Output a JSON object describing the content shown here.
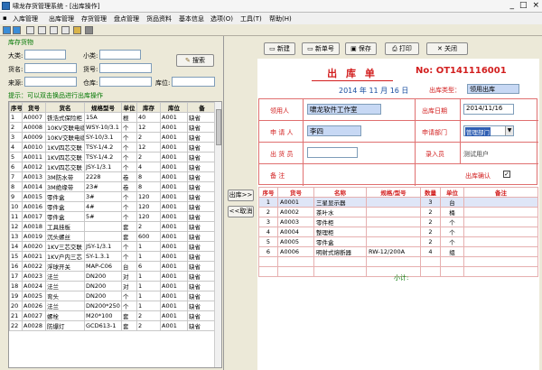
{
  "window": {
    "title": "啸龙存货管理系统 - [出库操作]",
    "controls": [
      "_",
      "□",
      "×"
    ]
  },
  "menu": [
    "入库管理",
    "出库管理",
    "存货管理",
    "盘点管理",
    "货品资料",
    "基本信息",
    "选项(O)",
    "工具(T)",
    "帮助(H)"
  ],
  "left": {
    "section_title": "库存货物",
    "filter": {
      "dalei_label": "大类:",
      "xiaolei_label": "小类:",
      "huoming_label": "货名:",
      "huohao_label": "货号:",
      "laiyuan_label": "来源:",
      "cangku_label": "仓库:",
      "kuwei_label": "库位:",
      "search_label": "搜索"
    },
    "hint": "提示：可以双击换品进行出库操作",
    "columns": [
      "序号",
      "货号",
      "货名",
      "规格型号",
      "单位",
      "库存",
      "库位",
      "备"
    ],
    "rows": [
      [
        "1",
        "A0007",
        "铁浩式保险柜",
        "15A",
        "根",
        "40",
        "A001",
        "缺省"
      ],
      [
        "2",
        "A0008",
        "10KV交联电缆",
        "WSY-10/3.1",
        "个",
        "12",
        "A001",
        "缺省"
      ],
      [
        "3",
        "A0009",
        "10KV交联电缆",
        "SY-10/3.1",
        "个",
        "2",
        "A001",
        "缺省"
      ],
      [
        "4",
        "A0010",
        "1KV四芯交联",
        "TSY-1/4.2",
        "个",
        "12",
        "A001",
        "缺省"
      ],
      [
        "5",
        "A0011",
        "1KV四芯交联",
        "TSY-1/4.2",
        "个",
        "2",
        "A001",
        "缺省"
      ],
      [
        "6",
        "A0012",
        "1KV四芯交联",
        "JSY-1/3.1",
        "个",
        "4",
        "A001",
        "缺省"
      ],
      [
        "7",
        "A0013",
        "3M防水带",
        "2228",
        "卷",
        "8",
        "A001",
        "缺省"
      ],
      [
        "8",
        "A0014",
        "3M绝缘带",
        "23#",
        "卷",
        "8",
        "A001",
        "缺省"
      ],
      [
        "9",
        "A0015",
        "零件盒",
        "3#",
        "个",
        "120",
        "A001",
        "缺省"
      ],
      [
        "10",
        "A0016",
        "零件盒",
        "4#",
        "个",
        "120",
        "A001",
        "缺省"
      ],
      [
        "11",
        "A0017",
        "零件盒",
        "5#",
        "个",
        "120",
        "A001",
        "缺省"
      ],
      [
        "12",
        "A0018",
        "工具挂板",
        "",
        "套",
        "2",
        "A001",
        "缺省"
      ],
      [
        "13",
        "A0019",
        "沉头螺丝",
        "",
        "套",
        "600",
        "A001",
        "缺省"
      ],
      [
        "14",
        "A0020",
        "1KV三芯交联",
        "JSY-1/3.1",
        "个",
        "1",
        "A001",
        "缺省"
      ],
      [
        "15",
        "A0021",
        "1KV户内三芯",
        "SY-1.3.1",
        "个",
        "1",
        "A001",
        "缺省"
      ],
      [
        "16",
        "A0022",
        "浮球开关",
        "MAP-C06",
        "台",
        "6",
        "A001",
        "缺省"
      ],
      [
        "17",
        "A0023",
        "法兰",
        "DN200",
        "对",
        "1",
        "A001",
        "缺省"
      ],
      [
        "18",
        "A0024",
        "法兰",
        "DN200",
        "对",
        "1",
        "A001",
        "缺省"
      ],
      [
        "19",
        "A0025",
        "弯头",
        "DN200",
        "个",
        "1",
        "A001",
        "缺省"
      ],
      [
        "20",
        "A0026",
        "法兰",
        "DN200*250",
        "个",
        "1",
        "A001",
        "缺省"
      ],
      [
        "21",
        "A0027",
        "螺栓",
        "M20*100",
        "套",
        "2",
        "A001",
        "缺省"
      ],
      [
        "22",
        "A0028",
        "防爆灯",
        "GCD613-1",
        "套",
        "2",
        "A001",
        "缺省"
      ]
    ]
  },
  "middle": {
    "out_button": "出库>>",
    "cancel_button": "<<取消"
  },
  "toolbar": {
    "new": "新建",
    "new_no": "新单号",
    "save": "保存",
    "print": "打印",
    "close": "关闭"
  },
  "form": {
    "title": "出 库 单",
    "number_label": "No:",
    "number": "OT141116001",
    "date": "2014 年 11 月 16 日",
    "type_label": "出库类型：",
    "type_value": "领用出库",
    "lingyongren_label": "领用人",
    "lingyongren_value": "啸龙软件工作室",
    "chuku_date_label": "出库日期",
    "chuku_date_value": "2014/11/16",
    "shenqingren_label": "申 请 人",
    "shenqingren_value": "李四",
    "shenqing_bumen_label": "申请部门",
    "shenqing_bumen_value": "管理部门",
    "chuhuo_yuan_label": "出 货 员",
    "chuhuo_yuan_value": "",
    "luru_label": "录入员",
    "luru_value": "测试用户",
    "beizhu_label": "备    注",
    "queren_label": "出库确认",
    "queren_checked": true,
    "columns": [
      "序号",
      "货号",
      "名称",
      "规格/型号",
      "数量",
      "单位",
      "备注"
    ],
    "items": [
      [
        "1",
        "A0001",
        "三星显示器",
        "",
        "3",
        "台",
        ""
      ],
      [
        "2",
        "A0002",
        "茶叶水",
        "",
        "2",
        "桶",
        ""
      ],
      [
        "3",
        "A0003",
        "零件柜",
        "",
        "2",
        "个",
        ""
      ],
      [
        "4",
        "A0004",
        "整理柜",
        "",
        "2",
        "个",
        ""
      ],
      [
        "5",
        "A0005",
        "零件盒",
        "",
        "2",
        "个",
        ""
      ],
      [
        "6",
        "A0006",
        "明射式熔断器",
        "RW-12/200A",
        "4",
        "组",
        ""
      ]
    ],
    "subtotal_label": "小计:"
  }
}
